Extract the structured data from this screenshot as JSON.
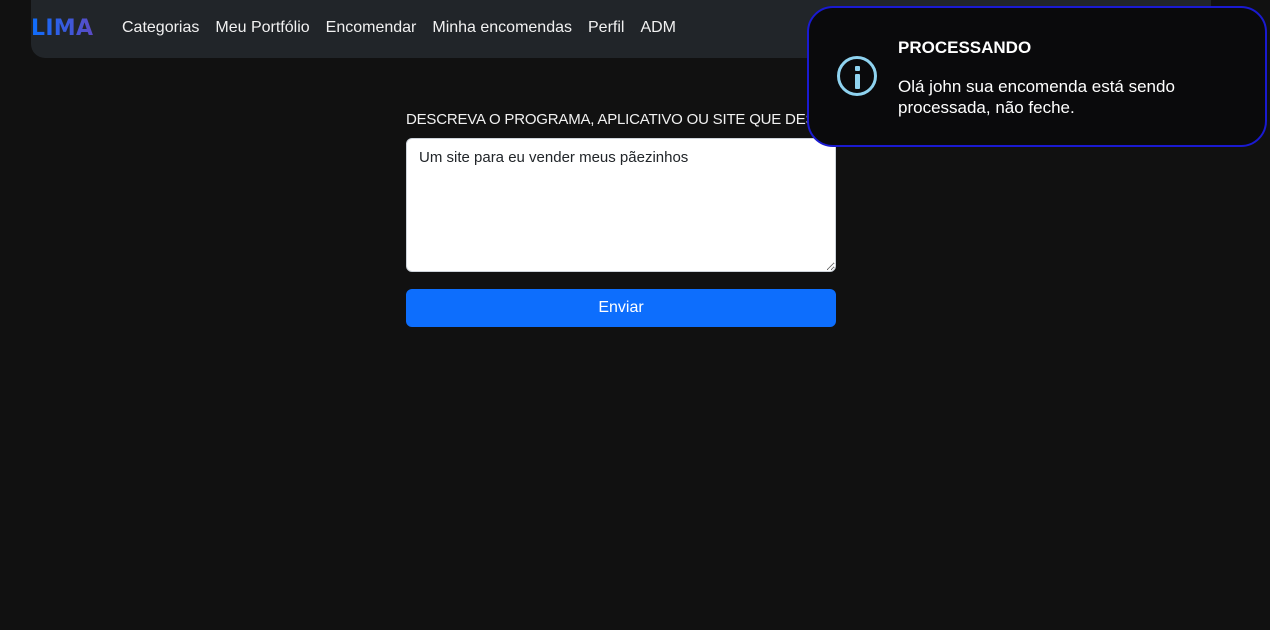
{
  "navbar": {
    "brand": "LIMA",
    "links": [
      {
        "label": "Categorias"
      },
      {
        "label": "Meu Portfólio"
      },
      {
        "label": "Encomendar"
      },
      {
        "label": "Minha encomendas"
      },
      {
        "label": "Perfil"
      },
      {
        "label": "ADM"
      }
    ]
  },
  "form": {
    "label": "DESCREVA O PROGRAMA, APLICATIVO OU SITE QUE DES",
    "textarea_value": "Um site para eu vender meus pãezinhos",
    "submit_label": "Enviar"
  },
  "toast": {
    "icon": "info-icon",
    "title": "PROCESSANDO",
    "message": "Olá john sua encomenda está sendo processada, não feche."
  },
  "colors": {
    "background": "#111111",
    "navbar": "#212529",
    "primary": "#0d6efd",
    "toast_border": "#1a1ad1",
    "info_icon": "#8fd3f0"
  }
}
